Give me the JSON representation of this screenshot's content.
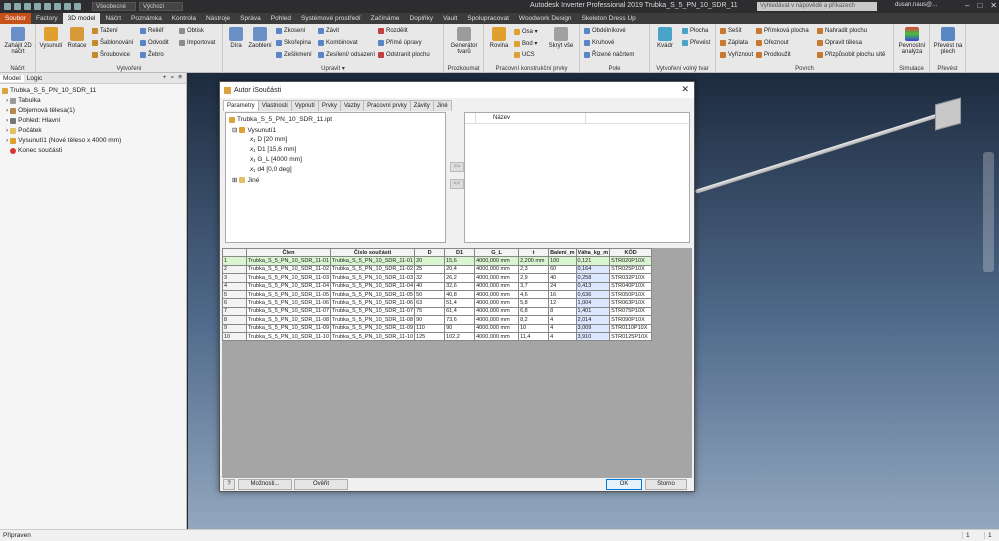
{
  "app": {
    "title": "Autodesk Inverter Professional 2019   Trubka_S_5_PN_10_SDR_11",
    "search_placeholder": "Vyhledávat v nápovědě a příkazech",
    "user": "dusan.naus@...",
    "combo_material": "Všeobecné",
    "combo_appearance": "Výchozí"
  },
  "tabs": [
    "Soubor",
    "Factory",
    "3D model",
    "Náčrt",
    "Poznámka",
    "Kontrola",
    "Nástroje",
    "Správa",
    "Pohled",
    "Systémové prostředí",
    "Začínáme",
    "Doplňky",
    "Vault",
    "Spolupracovat",
    "Woodwork Design",
    "Skeleton Dress Up"
  ],
  "ribbon": {
    "sketch": {
      "btn": "Zahájit 2D náčrt",
      "group": "Náčrt"
    },
    "create": {
      "btn1": "Vysunutí",
      "btn2": "Rotace",
      "small": [
        "Tažení",
        "Šablonování",
        "Šroubovice",
        "Reliéf",
        "Odvodit",
        "Žebro",
        "Obtisk",
        "Importovat"
      ],
      "group": "Vytvoření"
    },
    "modify": {
      "btn1": "Díra",
      "btn2": "Zaoblení",
      "small": [
        "Zkosení",
        "Skořepina",
        "Zešikmení",
        "Závit",
        "Kombinovat",
        "Zesílení/ odsazení",
        "Rozdělit",
        "Přímé úpravy",
        "Odstranit plochu"
      ],
      "group": "Upravit ▾"
    },
    "convert": {
      "btn": "Generátor tvarů",
      "group": "Prozkoumat"
    },
    "work": {
      "btn": "Rovina",
      "small": [
        "Osa ▾",
        "Bod ▾",
        "UCS"
      ],
      "btn2": "Skrýt vše",
      "group": "Pracovní konstrukční prvky"
    },
    "pattern": {
      "small": [
        "Obdélníkové",
        "Kruhové",
        "Řízené náčrtem"
      ],
      "group": "Pole"
    },
    "freeform": {
      "btn": "Kvádr",
      "small": [
        "Plocha",
        "Převést"
      ],
      "group": "Vytvoření volný tvar"
    },
    "surface": {
      "small": [
        "Sešít",
        "Záplata",
        "Vyříznout",
        "Přímková plocha",
        "Ořeznout",
        "Prodloužit",
        "Nahradit plochu",
        "Opravit tělesa",
        "Přizpůsobit plochu sítě"
      ],
      "group": "Povrch"
    },
    "sim": {
      "btn": "Pevnostní analýza",
      "group": "Simulace"
    },
    "sheet": {
      "btn": "Převést na plech",
      "group": "Převést"
    }
  },
  "browser": {
    "tabs": [
      "Model",
      "Logic"
    ],
    "nodes": [
      "Trubka_S_5_PN_10_SDR_11",
      "Tabulka",
      "Objemová tělesa(1)",
      "Pohled: Hlavní",
      "Počátek",
      "Vysunutí1 (Nové těleso x 4000 mm)",
      "Konec součásti"
    ]
  },
  "dialog": {
    "title": "Autor iSoučásti",
    "tabs": [
      "Parametry",
      "Vlastnosti",
      "Vypnutí",
      "Prvky",
      "Vazby",
      "Pracovní prvky",
      "Závity",
      "Jiné"
    ],
    "tree": [
      "Trubka_S_5_PN_10_SDR_11.ipt",
      "Vysunutí1",
      "D [20 mm]",
      "D1 [15,6 mm]",
      "G_L [4000 mm]",
      "d4 [0,0 deg]",
      "Jiné"
    ],
    "list_header": "Název",
    "buttons": {
      "help": "?",
      "options": "Možnosti...",
      "verify": "Ověřit",
      "ok": "OK",
      "cancel": "Storno"
    },
    "columns": [
      "",
      "Člen",
      "Číslo součásti",
      "D",
      "D1",
      "G_L",
      "t",
      "Balení_m",
      "Váha_kg_m",
      "KÓD"
    ],
    "rows": [
      [
        "1",
        "Trubka_S_5_PN_10_SDR_11-01",
        "Trubka_S_5_PN_10_SDR_11-01",
        "20",
        "15,6",
        "4000,000 mm",
        "2,200 mm",
        "100",
        "0,121",
        "STR020P10X"
      ],
      [
        "2",
        "Trubka_S_5_PN_10_SDR_11-02",
        "Trubka_S_5_PN_10_SDR_11-02",
        "25",
        "20,4",
        "4000,000 mm",
        "2,3",
        "60",
        "0,164",
        "STR025P10X"
      ],
      [
        "3",
        "Trubka_S_5_PN_10_SDR_11-03",
        "Trubka_S_5_PN_10_SDR_11-03",
        "32",
        "26,2",
        "4000,000 mm",
        "2,9",
        "40",
        "0,258",
        "STR032P10X"
      ],
      [
        "4",
        "Trubka_S_5_PN_10_SDR_11-04",
        "Trubka_S_5_PN_10_SDR_11-04",
        "40",
        "32,6",
        "4000,000 mm",
        "3,7",
        "24",
        "0,413",
        "STR040P10X"
      ],
      [
        "5",
        "Trubka_S_5_PN_10_SDR_11-05",
        "Trubka_S_5_PN_10_SDR_11-05",
        "50",
        "40,8",
        "4000,000 mm",
        "4,6",
        "16",
        "0,636",
        "STR050P10X"
      ],
      [
        "6",
        "Trubka_S_5_PN_10_SDR_11-06",
        "Trubka_S_5_PN_10_SDR_11-06",
        "63",
        "51,4",
        "4000,000 mm",
        "5,8",
        "12",
        "1,004",
        "STR063P10X"
      ],
      [
        "7",
        "Trubka_S_5_PN_10_SDR_11-07",
        "Trubka_S_5_PN_10_SDR_11-07",
        "75",
        "61,4",
        "4000,000 mm",
        "6,8",
        "8",
        "1,401",
        "STR075P10X"
      ],
      [
        "8",
        "Trubka_S_5_PN_10_SDR_11-08",
        "Trubka_S_5_PN_10_SDR_11-08",
        "90",
        "73,6",
        "4000,000 mm",
        "8,2",
        "4",
        "2,014",
        "STR090P10X"
      ],
      [
        "9",
        "Trubka_S_5_PN_10_SDR_11-09",
        "Trubka_S_5_PN_10_SDR_11-09",
        "110",
        "90",
        "4000,000 mm",
        "10",
        "4",
        "3,009",
        "STR0110P10X"
      ],
      [
        "10",
        "Trubka_S_5_PN_10_SDR_11-10",
        "Trubka_S_5_PN_10_SDR_11-10",
        "125",
        "102,2",
        "4000,000 mm",
        "11,4",
        "4",
        "3,910",
        "STR0125P10X"
      ]
    ]
  },
  "status": {
    "text": "Připraven",
    "page1": "1",
    "page2": "1"
  },
  "colors": {
    "file_tab": "#c5511a",
    "selected_row": "#d9f5d0",
    "key_column": "#dce6ff"
  }
}
